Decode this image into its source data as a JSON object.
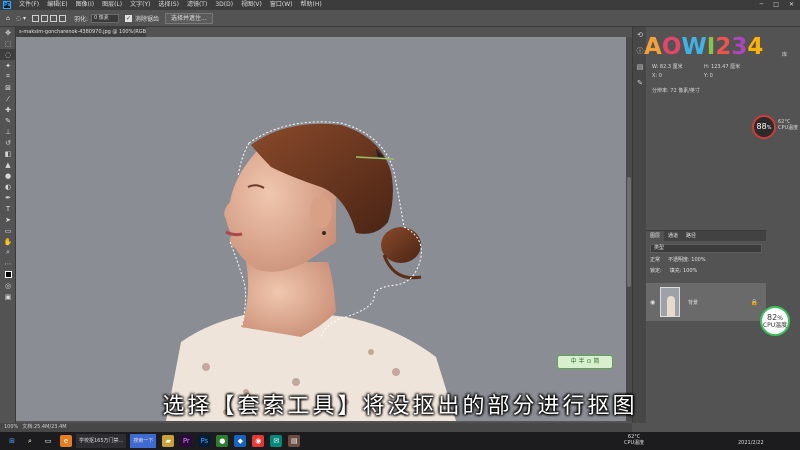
{
  "menubar": {
    "items": [
      "文件(F)",
      "编辑(E)",
      "图像(I)",
      "图层(L)",
      "文字(Y)",
      "选择(S)",
      "滤镜(T)",
      "3D(D)",
      "视图(V)",
      "窗口(W)",
      "帮助(H)"
    ]
  },
  "options": {
    "feather_label": "羽化:",
    "feather_value": "0 像素",
    "antialias_label": "消除锯齿",
    "mask_button": "选择并遮住..."
  },
  "document": {
    "tab": "s-maksim-goncharenok-4380970.jpg @ 100%(RGB/8)"
  },
  "status": {
    "zoom": "100%",
    "doc_info": "文档:25.4M/23.4M"
  },
  "properties": {
    "w": "W: 82.3 厘米",
    "h": "H: 123.47 厘米",
    "x": "X: 0",
    "y": "Y: 0",
    "resolution": "分辨率: 72 像素/英寸",
    "lib": "库"
  },
  "layers": {
    "tabs": [
      "图层",
      "通道",
      "路径"
    ],
    "search_placeholder": "类型",
    "blend_mode": "正常",
    "opacity": "不透明度: 100%",
    "lock": "锁定:",
    "fill": "填充: 100%",
    "layer_name": "背景"
  },
  "overlay": {
    "logo_chars": [
      "A",
      "O",
      "W",
      "I",
      "2",
      "3",
      "4"
    ],
    "cpu_red_value": "88",
    "cpu_red_unit": "%",
    "cpu_temp": "62°C",
    "cpu_label": "CPU温度",
    "cpu_green_value": "82",
    "cpu_green_unit": "%",
    "cpu_green_label": "CPU温度",
    "badge": "中 半 ⊙ 简",
    "subtitle": "选择【套索工具】将没抠出的部分进行抠图"
  },
  "taskbar": {
    "search_task": "学校抠165万门禁...",
    "search_label": "搜索一下",
    "temp": "62°C",
    "temp_label": "CPU温度",
    "date": "2021/2/22"
  },
  "colors": {
    "sky": "#8a8d93",
    "logo": [
      "#f2a13b",
      "#e6456b",
      "#3fb3e4",
      "#8bc34a",
      "#ef5350",
      "#ab47bc",
      "#ffb300"
    ]
  }
}
